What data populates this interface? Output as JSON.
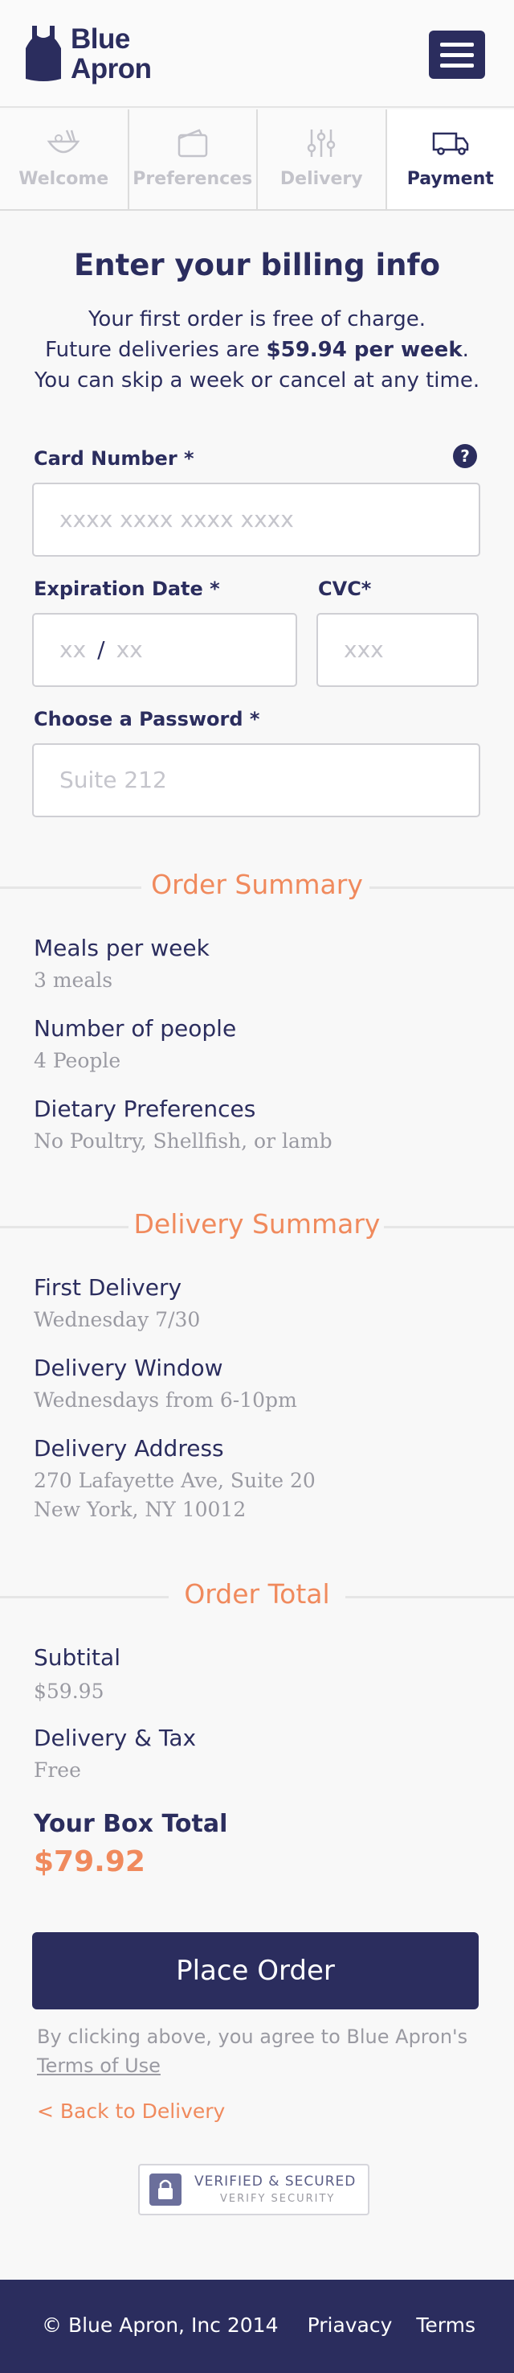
{
  "header": {
    "logo_text_line1": "Blue",
    "logo_text_line2": "Apron",
    "menu_icon": "hamburger-icon"
  },
  "steps": [
    {
      "label": "Welcome",
      "icon": "bowl-icon",
      "active": false
    },
    {
      "label": "Preferences",
      "icon": "wallet-icon",
      "active": false
    },
    {
      "label": "Delivery",
      "icon": "sliders-icon",
      "active": false
    },
    {
      "label": "Payment",
      "icon": "truck-icon",
      "active": true
    }
  ],
  "billing": {
    "title": "Enter your billing info",
    "line1": "Your first order is free of charge.",
    "line2_prefix": "Future deliveries are ",
    "line2_price": "$59.94 per week",
    "line2_suffix": ".",
    "line3": "You can skip a week or cancel at any time."
  },
  "form": {
    "card_label": "Card Number",
    "card_placeholder": "xxxx xxxx xxxx xxxx",
    "help_icon": "question-icon",
    "help_text": "?",
    "exp_label": "Expiration Date",
    "exp_month_placeholder": "xx",
    "exp_separator": "/",
    "exp_year_placeholder": "xx",
    "cvc_label": "CVC*",
    "cvc_placeholder": "xxx",
    "password_label": "Choose a Password",
    "password_placeholder": "Suite 212",
    "required_mark": "*"
  },
  "order_summary": {
    "heading": "Order Summary",
    "items": [
      {
        "label": "Meals per week",
        "value": "3 meals"
      },
      {
        "label": "Number of people",
        "value": "4 People"
      },
      {
        "label": "Dietary Preferences",
        "value": "No Poultry, Shellfish, or lamb"
      }
    ]
  },
  "delivery_summary": {
    "heading": "Delivery Summary",
    "items": [
      {
        "label": "First Delivery",
        "value": "Wednesday 7/30"
      },
      {
        "label": "Delivery Window",
        "value": "Wednesdays from 6-10pm"
      },
      {
        "label": "Delivery Address",
        "value": "270 Lafayette Ave, Suite 20",
        "value2": "New York, NY 10012"
      }
    ]
  },
  "order_total": {
    "heading": "Order Total",
    "items": [
      {
        "label": "Subtital",
        "value": "$59.95"
      },
      {
        "label": "Delivery & Tax",
        "value": "Free"
      }
    ],
    "box_total_label": "Your Box Total",
    "box_total_value": "$79.92"
  },
  "actions": {
    "place_order": "Place Order",
    "agree_text": "By clicking above, you agree to Blue Apron's",
    "terms_link": "Terms of Use",
    "back_link": "< Back to Delivery"
  },
  "secure_badge": {
    "line1": "VERIFIED & SECURED",
    "line2": "VERIFY SECURITY",
    "icon": "lock-icon"
  },
  "footer": {
    "copyright": "© Blue Apron, Inc 2014",
    "privacy": "Priavacy",
    "terms": "Terms"
  },
  "colors": {
    "brand_navy": "#2b2d5e",
    "accent_orange": "#f08a5d",
    "muted_gray": "#9a9aa2"
  }
}
